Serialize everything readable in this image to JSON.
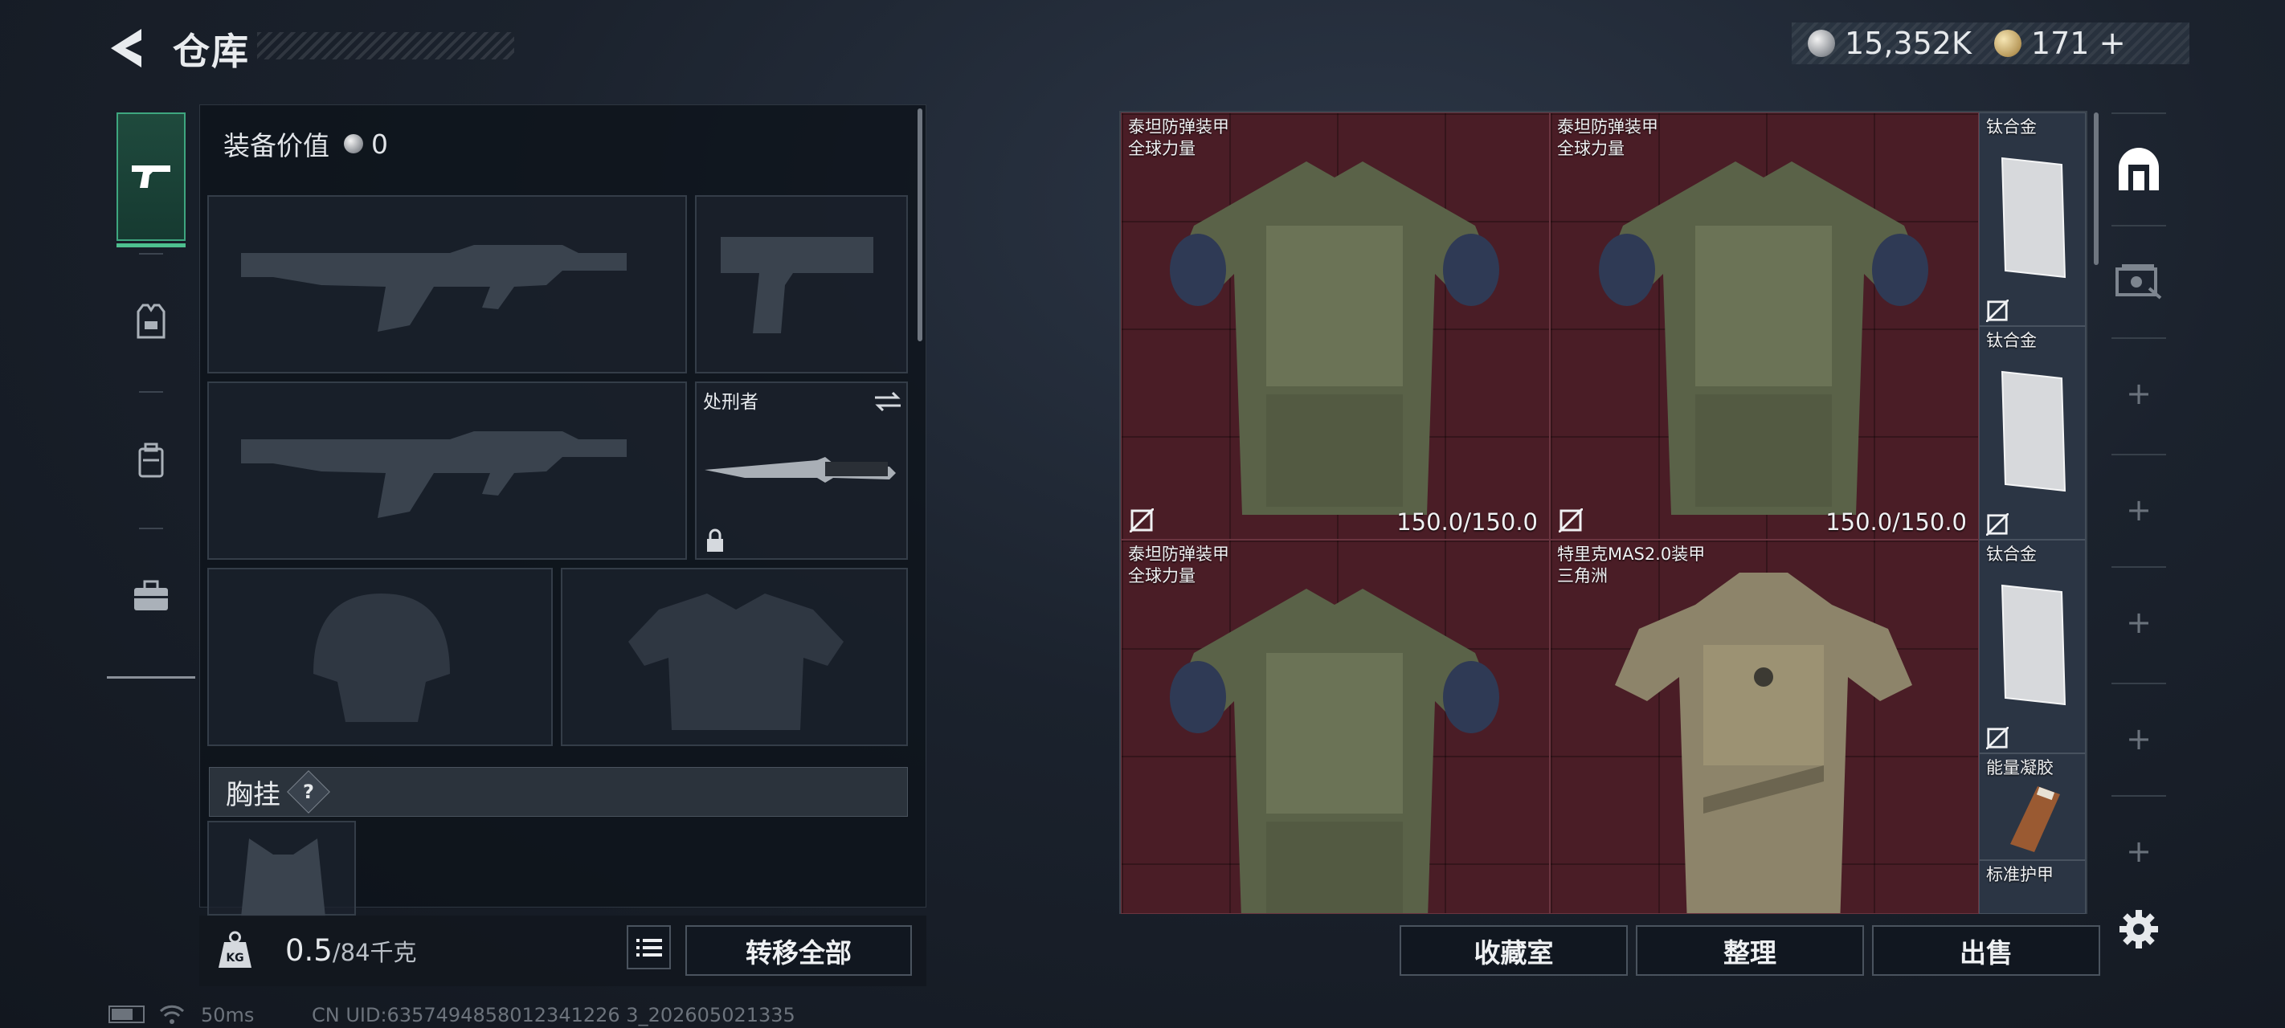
{
  "header": {
    "title": "仓库",
    "silver_amount": "15,352K",
    "gold_amount": "171",
    "plus_label": "+"
  },
  "equipment": {
    "value_label": "装备价值",
    "value_amount": "0",
    "knife_slot_name": "处刑者",
    "chest_rig_label": "胸挂",
    "help_label": "?"
  },
  "footer_left": {
    "weight_current": "0.5",
    "weight_max": "/84千克",
    "transfer_all": "转移全部"
  },
  "stash": {
    "items": [
      {
        "line1": "泰坦防弹装甲",
        "line2": "全球力量",
        "durability": "150.0/150.0"
      },
      {
        "line1": "泰坦防弹装甲",
        "line2": "全球力量",
        "durability": "150.0/150.0"
      },
      {
        "line1": "泰坦防弹装甲",
        "line2": "全球力量",
        "durability": ""
      },
      {
        "line1": "特里克MAS2.0装甲",
        "line2": "三角洲",
        "durability": ""
      }
    ],
    "small_items": [
      {
        "name": "钛合金"
      },
      {
        "name": "钛合金"
      },
      {
        "name": "钛合金"
      },
      {
        "name": "能量凝胶"
      },
      {
        "name": "标准护甲"
      }
    ]
  },
  "footer_right": {
    "collection": "收藏室",
    "organize": "整理",
    "sell": "出售"
  },
  "status": {
    "ping": "50ms",
    "uid": "CN UID:6357494858012341226 3_202605021335"
  },
  "colors": {
    "accent_green": "#3ea67f",
    "stash_cell_red": "#4a1d26"
  }
}
